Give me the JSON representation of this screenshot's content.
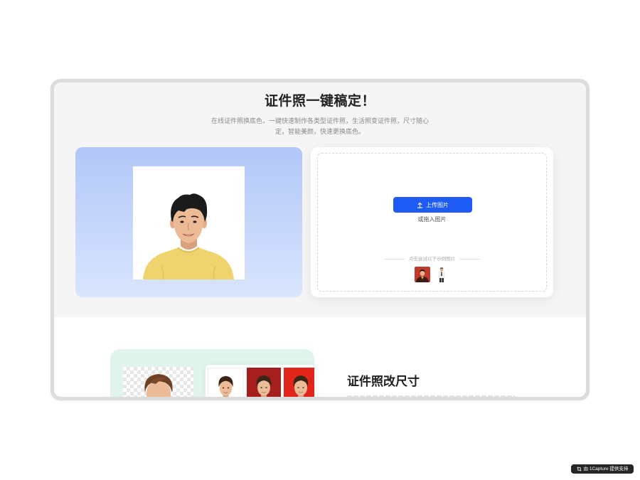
{
  "hero": {
    "title": "证件照一键稿定！",
    "subtitle_lines": [
      "在线证件照换底色，一键快速制作各类型证件照，生活照变证件照，尺寸随心",
      "定，智能美颜，快速更换底色。"
    ]
  },
  "uploader": {
    "button_label": "上传图片",
    "button_icon": "upload-icon",
    "drag_hint": "或拖入图片",
    "sample_hint": "点击尝试以下示例图片",
    "sample_backgrounds": [
      "#bf3a2d",
      "#ffffff"
    ]
  },
  "feature": {
    "title": "证件照改尺寸",
    "background_options": [
      "#ffffff",
      "#a61f1f",
      "#e2251b"
    ]
  },
  "badge": {
    "icon": "crop-icon",
    "text": "由 1Capture 提供支持"
  },
  "colors": {
    "accent": "#1f5cf6",
    "hero_background": "#f5f5f5",
    "preview_gradient_top": "#b1c7f8",
    "preview_gradient_bottom": "#d9e5fd",
    "feature_background": "#e0f4eb",
    "badge_background": "#262626"
  }
}
